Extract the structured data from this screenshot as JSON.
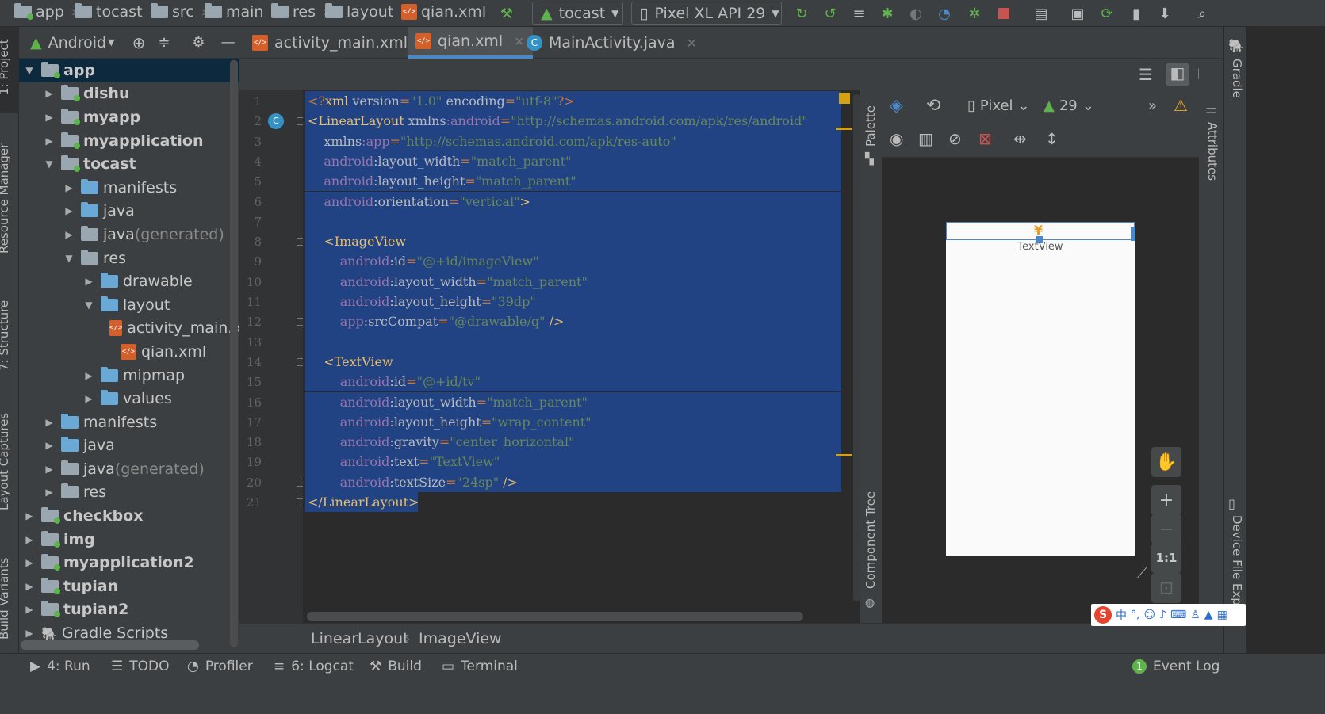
{
  "breadcrumbs": [
    "app",
    "tocast",
    "src",
    "main",
    "res",
    "layout",
    "qian.xml"
  ],
  "toolbar": {
    "module_combo": "tocast",
    "device_combo": "Pixel XL API 29"
  },
  "left_strip_tabs": [
    "1: Project",
    "Resource Manager",
    "7: Structure",
    "Layout Captures",
    "Build Variants"
  ],
  "project_panel": {
    "view_mode": "Android"
  },
  "tree": [
    {
      "label": "app",
      "suffix": "",
      "depth": 0,
      "expanded": true,
      "bold": true,
      "icon": "module-folder-icon",
      "selected": true
    },
    {
      "label": "dishu",
      "suffix": "",
      "depth": 1,
      "expanded": false,
      "bold": true,
      "icon": "module-folder-icon"
    },
    {
      "label": "myapp",
      "suffix": "",
      "depth": 1,
      "expanded": false,
      "bold": true,
      "icon": "module-folder-icon"
    },
    {
      "label": "myapplication",
      "suffix": "",
      "depth": 1,
      "expanded": false,
      "bold": true,
      "icon": "module-folder-icon"
    },
    {
      "label": "tocast",
      "suffix": "",
      "depth": 1,
      "expanded": true,
      "bold": true,
      "icon": "module-folder-icon"
    },
    {
      "label": "manifests",
      "suffix": "",
      "depth": 2,
      "expanded": false,
      "bold": false,
      "icon": "folder-icon"
    },
    {
      "label": "java",
      "suffix": "",
      "depth": 2,
      "expanded": false,
      "bold": false,
      "icon": "folder-icon"
    },
    {
      "label": "java",
      "suffix": " (generated)",
      "depth": 2,
      "expanded": false,
      "bold": false,
      "icon": "generated-folder-icon"
    },
    {
      "label": "res",
      "suffix": "",
      "depth": 2,
      "expanded": true,
      "bold": false,
      "icon": "res-folder-icon"
    },
    {
      "label": "drawable",
      "suffix": "",
      "depth": 3,
      "expanded": false,
      "bold": false,
      "icon": "folder-icon"
    },
    {
      "label": "layout",
      "suffix": "",
      "depth": 3,
      "expanded": true,
      "bold": false,
      "icon": "folder-icon"
    },
    {
      "label": "activity_main.x",
      "suffix": "",
      "depth": 4,
      "leaf": true,
      "bold": false,
      "icon": "xml-file-icon"
    },
    {
      "label": "qian.xml",
      "suffix": "",
      "depth": 4,
      "leaf": true,
      "bold": false,
      "icon": "xml-file-icon"
    },
    {
      "label": "mipmap",
      "suffix": "",
      "depth": 3,
      "expanded": false,
      "bold": false,
      "icon": "folder-icon"
    },
    {
      "label": "values",
      "suffix": "",
      "depth": 3,
      "expanded": false,
      "bold": false,
      "icon": "folder-icon"
    },
    {
      "label": "manifests",
      "suffix": "",
      "depth": 1,
      "expanded": false,
      "bold": false,
      "icon": "folder-icon"
    },
    {
      "label": "java",
      "suffix": "",
      "depth": 1,
      "expanded": false,
      "bold": false,
      "icon": "folder-icon"
    },
    {
      "label": "java",
      "suffix": " (generated)",
      "depth": 1,
      "expanded": false,
      "bold": false,
      "icon": "generated-folder-icon"
    },
    {
      "label": "res",
      "suffix": "",
      "depth": 1,
      "expanded": false,
      "bold": false,
      "icon": "res-folder-icon"
    },
    {
      "label": "checkbox",
      "suffix": "",
      "depth": 0,
      "expanded": false,
      "bold": true,
      "icon": "module-folder-icon"
    },
    {
      "label": "img",
      "suffix": "",
      "depth": 0,
      "expanded": false,
      "bold": true,
      "icon": "module-folder-icon"
    },
    {
      "label": "myapplication2",
      "suffix": "",
      "depth": 0,
      "expanded": false,
      "bold": true,
      "icon": "module-folder-icon"
    },
    {
      "label": "tupian",
      "suffix": "",
      "depth": 0,
      "expanded": false,
      "bold": true,
      "icon": "module-folder-icon"
    },
    {
      "label": "tupian2",
      "suffix": "",
      "depth": 0,
      "expanded": false,
      "bold": true,
      "icon": "module-folder-icon"
    },
    {
      "label": "Gradle Scripts",
      "suffix": "",
      "depth": 0,
      "expanded": false,
      "bold": false,
      "icon": "gradle-icon"
    }
  ],
  "editor_tabs": [
    {
      "label": "activity_main.xml",
      "icon": "xml-file-icon",
      "active": false
    },
    {
      "label": "qian.xml",
      "icon": "xml-file-icon",
      "active": true
    },
    {
      "label": "MainActivity.java",
      "icon": "java-class-icon",
      "active": false
    }
  ],
  "code_lines": [
    {
      "n": "1",
      "parts": [
        [
          "pun",
          "<?"
        ],
        [
          "tag",
          "xml "
        ],
        [
          "attr",
          "version"
        ],
        [
          "pun",
          "="
        ],
        [
          "val",
          "\"1.0\""
        ],
        [
          "tag",
          " "
        ],
        [
          "attr",
          "encoding"
        ],
        [
          "pun",
          "="
        ],
        [
          "val",
          "\"utf-8\""
        ],
        [
          "pun",
          "?>"
        ]
      ]
    },
    {
      "n": "2",
      "parts": [
        [
          "tag",
          "<LinearLayout "
        ],
        [
          "attr",
          "xmlns"
        ],
        [
          "ns",
          ":android"
        ],
        [
          "pun",
          "="
        ],
        [
          "val",
          "\"http://schemas.android.com/apk/res/android\""
        ]
      ]
    },
    {
      "n": "3",
      "parts": [
        [
          "tag",
          "    "
        ],
        [
          "attr",
          "xmlns"
        ],
        [
          "ns",
          ":app"
        ],
        [
          "pun",
          "="
        ],
        [
          "val",
          "\"http://schemas.android.com/apk/res-auto\""
        ]
      ]
    },
    {
      "n": "4",
      "parts": [
        [
          "tag",
          "    "
        ],
        [
          "ns",
          "android"
        ],
        [
          "attr",
          ":layout_width"
        ],
        [
          "pun",
          "="
        ],
        [
          "val",
          "\"match_parent\""
        ]
      ]
    },
    {
      "n": "5",
      "parts": [
        [
          "tag",
          "    "
        ],
        [
          "ns",
          "android"
        ],
        [
          "attr",
          ":layout_height"
        ],
        [
          "pun",
          "="
        ],
        [
          "val",
          "\"match_parent\""
        ]
      ]
    },
    {
      "n": "6",
      "parts": [
        [
          "tag",
          "    "
        ],
        [
          "ns",
          "android"
        ],
        [
          "attr",
          ":orientation"
        ],
        [
          "pun",
          "="
        ],
        [
          "val",
          "\"vertical\""
        ],
        [
          "tag",
          ">"
        ]
      ]
    },
    {
      "n": "7",
      "parts": [
        [
          "tag",
          ""
        ]
      ]
    },
    {
      "n": "8",
      "parts": [
        [
          "tag",
          "    <ImageView"
        ]
      ]
    },
    {
      "n": "9",
      "parts": [
        [
          "tag",
          "        "
        ],
        [
          "ns",
          "android"
        ],
        [
          "attr",
          ":id"
        ],
        [
          "pun",
          "="
        ],
        [
          "val",
          "\"@+id/imageView\""
        ]
      ]
    },
    {
      "n": "10",
      "parts": [
        [
          "tag",
          "        "
        ],
        [
          "ns",
          "android"
        ],
        [
          "attr",
          ":layout_width"
        ],
        [
          "pun",
          "="
        ],
        [
          "val",
          "\"match_parent\""
        ]
      ]
    },
    {
      "n": "11",
      "parts": [
        [
          "tag",
          "        "
        ],
        [
          "ns",
          "android"
        ],
        [
          "attr",
          ":layout_height"
        ],
        [
          "pun",
          "="
        ],
        [
          "val",
          "\"39dp\""
        ]
      ]
    },
    {
      "n": "12",
      "parts": [
        [
          "tag",
          "        "
        ],
        [
          "ns",
          "app"
        ],
        [
          "attr",
          ":srcCompat"
        ],
        [
          "pun",
          "="
        ],
        [
          "val",
          "\"@drawable/q\""
        ],
        [
          "tag",
          " />"
        ]
      ]
    },
    {
      "n": "13",
      "parts": [
        [
          "tag",
          ""
        ]
      ]
    },
    {
      "n": "14",
      "parts": [
        [
          "tag",
          "    <TextView"
        ]
      ]
    },
    {
      "n": "15",
      "parts": [
        [
          "tag",
          "        "
        ],
        [
          "ns",
          "android"
        ],
        [
          "attr",
          ":id"
        ],
        [
          "pun",
          "="
        ],
        [
          "val",
          "\"@+id/tv\""
        ]
      ]
    },
    {
      "n": "16",
      "parts": [
        [
          "tag",
          "        "
        ],
        [
          "ns",
          "android"
        ],
        [
          "attr",
          ":layout_width"
        ],
        [
          "pun",
          "="
        ],
        [
          "val",
          "\"match_parent\""
        ]
      ]
    },
    {
      "n": "17",
      "parts": [
        [
          "tag",
          "        "
        ],
        [
          "ns",
          "android"
        ],
        [
          "attr",
          ":layout_height"
        ],
        [
          "pun",
          "="
        ],
        [
          "val",
          "\"wrap_content\""
        ]
      ]
    },
    {
      "n": "18",
      "parts": [
        [
          "tag",
          "        "
        ],
        [
          "ns",
          "android"
        ],
        [
          "attr",
          ":gravity"
        ],
        [
          "pun",
          "="
        ],
        [
          "val",
          "\"center_horizontal\""
        ]
      ]
    },
    {
      "n": "19",
      "parts": [
        [
          "tag",
          "        "
        ],
        [
          "ns",
          "android"
        ],
        [
          "attr",
          ":text"
        ],
        [
          "pun",
          "="
        ],
        [
          "val",
          "\"TextView\""
        ]
      ]
    },
    {
      "n": "20",
      "parts": [
        [
          "tag",
          "        "
        ],
        [
          "ns",
          "android"
        ],
        [
          "attr",
          ":textSize"
        ],
        [
          "pun",
          "="
        ],
        [
          "val",
          "\"24sp\""
        ],
        [
          "tag",
          " />"
        ]
      ]
    },
    {
      "n": "21",
      "parts": [
        [
          "tag",
          "</LinearLayout>"
        ]
      ]
    }
  ],
  "design": {
    "palette_label": "Palette",
    "component_tree_label": "Component Tree",
    "device_combo": "Pixel",
    "api_combo": "29",
    "preview_text": "TextView",
    "zoom_one_to_one": "1:1"
  },
  "right_strip_tabs": [
    "Gradle",
    "Attributes",
    "Device File Explo"
  ],
  "editor_breadcrumb": [
    "LinearLayout",
    "ImageView"
  ],
  "bottom_tabs": [
    {
      "label": "4: Run",
      "icon": "run-icon"
    },
    {
      "label": "TODO",
      "icon": "todo-icon"
    },
    {
      "label": "Profiler",
      "icon": "profiler-icon"
    },
    {
      "label": "6: Logcat",
      "icon": "logcat-icon"
    },
    {
      "label": "Build",
      "icon": "build-icon"
    },
    {
      "label": "Terminal",
      "icon": "terminal-icon"
    }
  ],
  "event_log": {
    "label": "Event Log",
    "count": "1"
  },
  "ime_tray": "中"
}
